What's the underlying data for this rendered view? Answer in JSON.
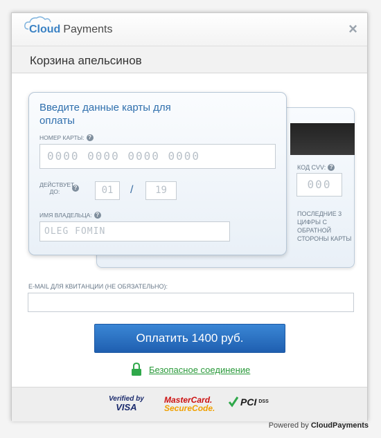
{
  "header": {
    "logo_cloud": "Cloud",
    "logo_payments": "Payments",
    "close_glyph": "×"
  },
  "title": "Корзина апельсинов",
  "card_front": {
    "heading": "Введите данные карты для оплаты",
    "card_number_label": "НОМЕР КАРТЫ:",
    "card_number_placeholder": "0000 0000 0000 0000",
    "expiry_label": "ДЕЙСТВУЕТ ДО:",
    "expiry_month": "01",
    "expiry_separator": "/",
    "expiry_year": "19",
    "holder_label": "ИМЯ ВЛАДЕЛЬЦА:",
    "holder_placeholder": "OLEG FOMIN",
    "help_glyph": "?"
  },
  "card_back": {
    "cvv_label": "КОД CVV:",
    "cvv_placeholder": "000",
    "cvv_hint": "ПОСЛЕДНИЕ 3 ЦИФРЫ С ОБРАТНОЙ СТОРОНЫ КАРТЫ"
  },
  "email": {
    "label": "E-MAIL ДЛЯ КВИТАНЦИИ (НЕ ОБЯЗАТЕЛЬНО):",
    "value": ""
  },
  "pay_button": "Оплатить 1400 руб.",
  "secure_link": "Безопасное соединение",
  "footer": {
    "visa_line1": "Verified by",
    "visa_line2": "VISA",
    "mc_line1": "MasterCard.",
    "mc_line2": "SecureCode.",
    "pci_text": "PCI",
    "dss_text": "DSS"
  },
  "powered_prefix": "Powered by",
  "powered_brand": "CloudPayments",
  "colors": {
    "accent_blue": "#2f6fad",
    "button_blue": "#2a74c8",
    "secure_green": "#2a9a3a"
  }
}
